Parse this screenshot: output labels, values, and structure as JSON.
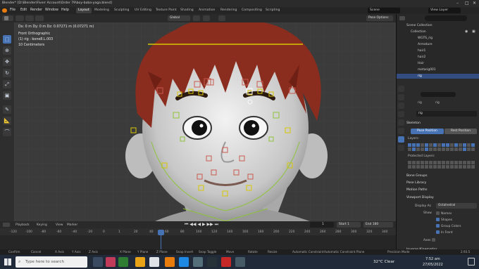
{
  "window": {
    "title": "Blender* [D:\\Blender\\Fiverr Account\\Order 79\\boy-baba-yaga.blend]"
  },
  "menu": [
    "File",
    "Edit",
    "Render",
    "Window",
    "Help"
  ],
  "workspaces": [
    "Layout",
    "Modeling",
    "Sculpting",
    "UV Editing",
    "Texture Paint",
    "Shading",
    "Animation",
    "Rendering",
    "Compositing",
    "Scripting"
  ],
  "active_workspace": "Layout",
  "scene": {
    "scene_name": "Scene",
    "view_layer": "View Layer"
  },
  "viewport_header": {
    "orientation": "Global",
    "pose_options": "Pose Options",
    "measure_readout": "Dx: 0 m  Dy: 0 m  Dz: 0.07271 m (0.07271 m)"
  },
  "viewport_overlay": {
    "view_name": "Front Orthographic",
    "object_info": "(1) rig : bone8.L.003",
    "unit_info": "10 Centimeters"
  },
  "outliner": {
    "title": "Scene Collection",
    "items": [
      {
        "label": "Collection",
        "selected": false
      },
      {
        "label": "WGTS_rig",
        "selected": false
      },
      {
        "label": "Armature",
        "selected": false
      },
      {
        "label": "hair1",
        "selected": false
      },
      {
        "label": "hair2",
        "selected": false
      },
      {
        "label": "Hair",
        "selected": false
      },
      {
        "label": "metarig001",
        "selected": false
      },
      {
        "label": "rig",
        "selected": true
      }
    ]
  },
  "properties": {
    "breadcrumb_object": "rig",
    "breadcrumb_data": "rig",
    "data_name": "rig",
    "skeleton_label": "Skeleton",
    "pose_position": "Pose Position",
    "rest_position": "Rest Position",
    "layers_label": "Layers:",
    "protected_layers_label": "Protected Layers:",
    "panels": [
      "Bone Groups",
      "Pose Library",
      "Motion Paths"
    ],
    "viewport_display_label": "Viewport Display",
    "display_as_label": "Display As",
    "display_as_value": "Octahedral",
    "show_label": "Show",
    "show_options": [
      "Names",
      "Shapes",
      "Group Colors",
      "In Front"
    ],
    "axes_label": "Axes",
    "inverse_kinematics_label": "Inverse Kinematics"
  },
  "timeline": {
    "menus": [
      "Playback",
      "Keying",
      "View",
      "Marker"
    ],
    "current_frame": "1",
    "start_label": "Start",
    "start_value": "1",
    "end_label": "End",
    "end_value": "180",
    "ruler": [
      "-120",
      "-100",
      "-80",
      "-60",
      "-40",
      "-20",
      "0",
      "1",
      "20",
      "40",
      "60",
      "80",
      "100",
      "120",
      "140",
      "160",
      "180",
      "200",
      "220",
      "240",
      "260",
      "280",
      "300",
      "320",
      "340"
    ]
  },
  "statusbar": {
    "items": [
      "Confirm",
      "Cancel",
      "X Axis",
      "Y Axis",
      "Z Axis",
      "X Plane",
      "Y Plane",
      "Z Plane",
      "Snap Invert",
      "Snap Toggle",
      "Move",
      "Rotate",
      "Resize",
      "Automatic Constraint",
      "Automatic Constraint Plane",
      "Precision Mode"
    ],
    "version": "2.93.5"
  },
  "taskbar": {
    "search_placeholder": "Type here to search",
    "weather": "32°C  Clear",
    "time": "7:52 am",
    "date": "27/05/2022"
  },
  "colors": {
    "accent": "#4772b3",
    "bone_yellow": "#d8c800",
    "bone_green": "#8fc43c",
    "bone_red": "#c85a50",
    "hair": "#8a2c1e"
  }
}
